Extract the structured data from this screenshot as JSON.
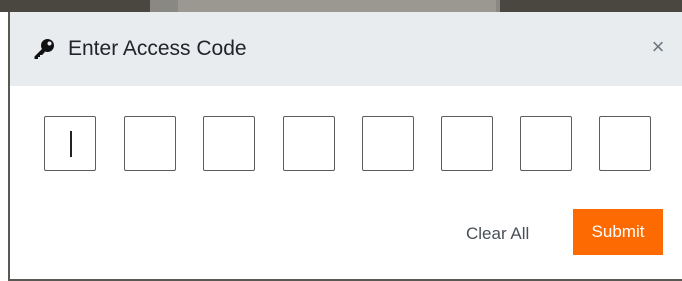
{
  "dialog": {
    "title": "Enter Access Code",
    "title_icon": "key-icon",
    "close_label": "×",
    "close_icon": "close-icon"
  },
  "code_inputs": [
    {
      "value": ""
    },
    {
      "value": ""
    },
    {
      "value": ""
    },
    {
      "value": ""
    },
    {
      "value": ""
    },
    {
      "value": ""
    },
    {
      "value": ""
    },
    {
      "value": ""
    }
  ],
  "actions": {
    "clear_label": "Clear All",
    "submit_label": "Submit"
  },
  "colors": {
    "header_bg": "#e9ecef",
    "submit_bg": "#fd6a02",
    "submit_text": "#ffffff"
  }
}
